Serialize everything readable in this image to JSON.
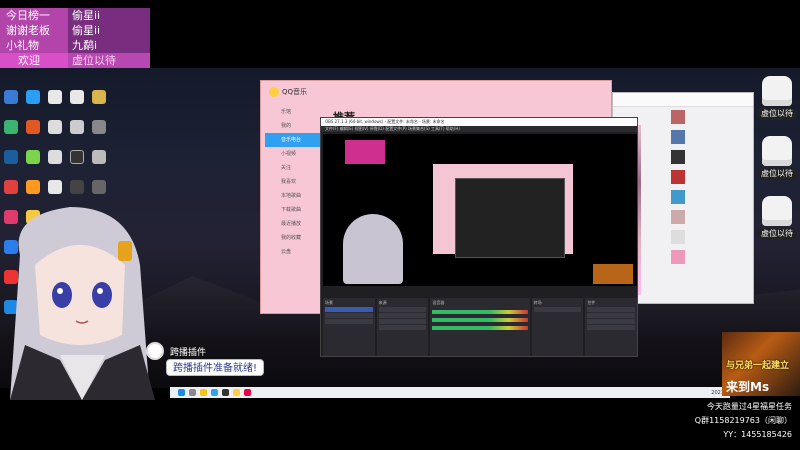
{
  "ticker": [
    {
      "key": "今日榜一",
      "value": "偷星ii"
    },
    {
      "key": "谢谢老板",
      "value": "偷星ii"
    },
    {
      "key": "小礼物",
      "value": "九鹬i"
    },
    {
      "key": "欢迎",
      "value": "虚位以待"
    }
  ],
  "qq_music": {
    "app_name": "QQ音乐",
    "page_title": "推荐",
    "side_items": [
      "乐馆",
      "我的",
      "音乐电台",
      "小视频",
      "关注",
      "我喜欢",
      "本地歌曲",
      "下载歌曲",
      "最近播放",
      "我的收藏",
      "云盘"
    ]
  },
  "obs": {
    "title": "OBS 27.1.3 (64-bit, windows) - 配置文件: 未命名 - 场景: 未命名",
    "menu": "文件(F)  编辑(E)  视图(V)  停靠(D)  配置文件(P)  场景集合(S)  工具(T)  帮助(H)",
    "docks": [
      {
        "header": "场景"
      },
      {
        "header": "来源"
      },
      {
        "header": "混音器"
      },
      {
        "header": "转场"
      },
      {
        "header": "控件"
      }
    ]
  },
  "queue_slots": [
    {
      "label": "虚位以待"
    },
    {
      "label": "虚位以待"
    },
    {
      "label": "虚位以待"
    }
  ],
  "ad": {
    "headline": "与兄弟一起建立",
    "cta": "来到Ms"
  },
  "taskbar": {
    "clock": "2021"
  },
  "chat": {
    "name": "跨播插件",
    "message": "跨播插件准备就绪!"
  },
  "info": {
    "line1": "今天跑量过4星福星任务",
    "line2": "Q群1158219763（闲聊）",
    "line3": "YY：1455185426"
  },
  "colors": {
    "ticker_key": "#d94fc7",
    "ticker_value": "#b747b1",
    "qq_pink": "#f7c7d6",
    "qq_selected": "#2fa1f0",
    "chat_text": "#2b3a8a"
  }
}
